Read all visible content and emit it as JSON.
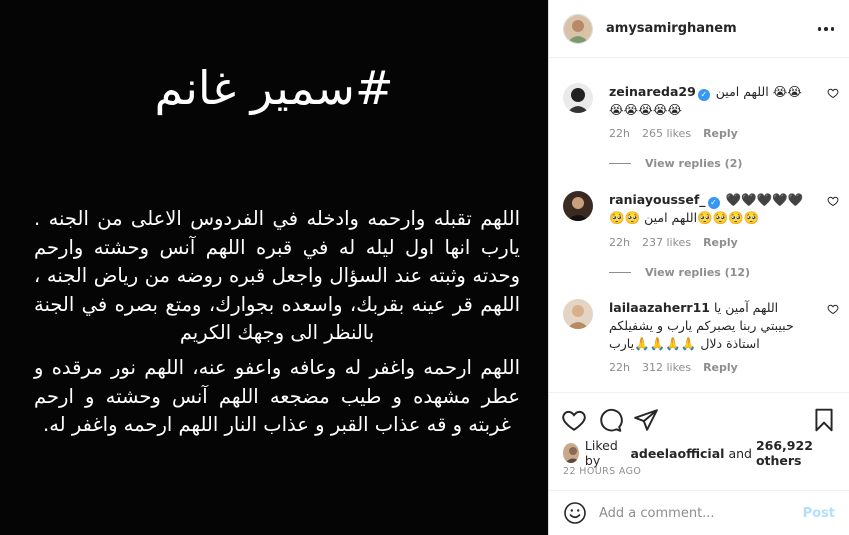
{
  "post_image": {
    "hashtag": "#سمير غانم",
    "paragraph1": "اللهم تقبله وارحمه وادخله في الفردوس الاعلى من الجنه . يارب انها اول ليله له في قبره اللهم آنس وحشته وارحم وحدته وثبته عند السؤال واجعل قبره روضه من رياض الجنه ، اللهم قر عينه بقربك، واسعده بجوارك، ومتع بصره في الجنة بالنظر الى وجهك الكريم",
    "paragraph2": "اللهم ارحمه واغفر له وعافه واعفو عنه، اللهم نور مرقده و عطر مشهده و طيب مضجعه اللهم آنس وحشته و ارحم غربته و قه عذاب القبر و عذاب النار اللهم ارحمه واغفر له."
  },
  "header": {
    "username": "amysamirghanem"
  },
  "comments": [
    {
      "username": "zeinareda29",
      "text": "اللهم امين 😭😭😭😭😭😭😭",
      "time": "22h",
      "likes": "265 likes",
      "reply": "Reply",
      "view_replies": "View replies (2)"
    },
    {
      "username": "raniayoussef_",
      "text": "🖤🖤🖤🖤🖤🥺🥺 اللهم امين🥺🥺🥺🥺",
      "time": "22h",
      "likes": "237 likes",
      "reply": "Reply",
      "view_replies": "View replies (12)"
    },
    {
      "username": "lailaazaherr11",
      "text": "اللهم آمين يا حبيبتي ربنا يصبركم يارب و يشفيلكم استاذة دلال 🙏🙏🙏🙏يارب",
      "time": "22h",
      "likes": "312 likes",
      "reply": "Reply"
    }
  ],
  "actions": {
    "liked_prefix": "Liked by",
    "liked_user": "adeelaofficial",
    "liked_and": "and",
    "liked_others": "266,922 others",
    "timestamp": "22 HOURS AGO"
  },
  "add_comment": {
    "placeholder": "Add a comment...",
    "post_label": "Post"
  },
  "colors": {
    "verified": "#3897f0",
    "post_disabled": "#b2dffc",
    "image_background": "#050505"
  },
  "icons": [
    "more-icon",
    "heart-icon",
    "comment-icon",
    "share-icon",
    "bookmark-icon",
    "emoji-icon",
    "verified-icon"
  ]
}
